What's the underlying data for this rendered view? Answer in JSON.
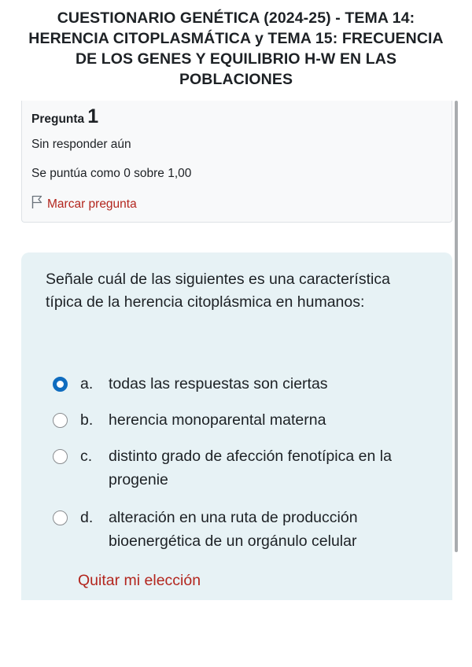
{
  "quiz": {
    "title_lines": [
      "CUESTIONARIO GENÉTICA (2024-25) - TEMA 14:",
      "HERENCIA CITOPLASMÁTICA y TEMA 15: FRECUENCIA",
      "DE LOS GENES Y EQUILIBRIO H-W EN LAS",
      "POBLACIONES"
    ]
  },
  "question_info": {
    "label": "Pregunta",
    "number": "1",
    "status": "Sin responder aún",
    "grade": "Se puntúa como 0 sobre 1,00",
    "flag_label": "Marcar pregunta",
    "flag_icon": "flag-outline-icon"
  },
  "question": {
    "text": "Señale cuál de las siguientes es una característica típica de la herencia citoplásmica en humanos:",
    "answers": [
      {
        "letter": "a.",
        "text": "todas las respuestas son ciertas",
        "selected": true
      },
      {
        "letter": "b.",
        "text": "herencia monoparental materna",
        "selected": false
      },
      {
        "letter": "c.",
        "text": "distinto grado de afección fenotípica en la progenie",
        "selected": false
      },
      {
        "letter": "d.",
        "text": "alteración en una ruta de producción bioenergética de un orgánulo celular",
        "selected": false
      }
    ],
    "clear_label": "Quitar mi elección"
  },
  "colors": {
    "accent_blue": "#0f6cbf",
    "link_red": "#b3261e",
    "formulation_bg": "#e7f2f5"
  }
}
